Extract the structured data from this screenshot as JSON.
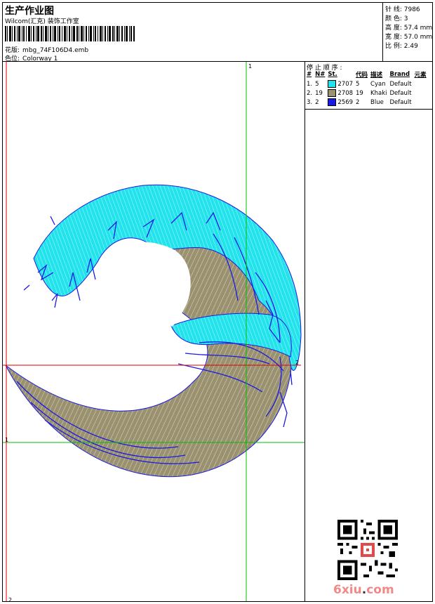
{
  "header": {
    "title": "生产作业图",
    "company": "Wilcom(汇克) 装饰工作室",
    "design_label": "花版:",
    "design_value": "mbg_74F106D4.emb",
    "colorway_label": "色位:",
    "colorway_value": "Colorway 1"
  },
  "stats": {
    "stitches": "针 线: 7986",
    "colors": "颜 色: 3",
    "height": "高 度: 57.4 mm",
    "width": "宽 度: 57.0 mm",
    "scale": "比 例: 2.49"
  },
  "stop_sequence": {
    "title": "停 止 顺 序 :",
    "columns": [
      "#",
      "N#",
      "St.",
      "代码",
      "描述",
      "Brand",
      "元素"
    ],
    "rows": [
      {
        "num": "1.",
        "n": "5",
        "code_thread": "2707",
        "code": "5",
        "desc": "Cyan",
        "brand": "Default",
        "color": "#22e3ec"
      },
      {
        "num": "2.",
        "n": "19",
        "code_thread": "2708",
        "code": "19",
        "desc": "Khaki",
        "brand": "Default",
        "color": "#9a9170"
      },
      {
        "num": "3.",
        "n": "2",
        "code_thread": "2569",
        "code": "2",
        "desc": "Blue",
        "brand": "Default",
        "color": "#1a1ae6"
      }
    ]
  },
  "axes": {
    "top_marker": "1",
    "right_marker": "2",
    "left_marker": "1",
    "bottom_marker": "2"
  },
  "watermark": {
    "site_prefix": "6xiu",
    "site_dot": ".",
    "site_suffix": "com"
  },
  "colors": {
    "cyan": "#22e3ec",
    "khaki": "#9a9170",
    "blue": "#1a1ae6",
    "guide_green": "#00c000",
    "guide_red": "#e00000"
  }
}
